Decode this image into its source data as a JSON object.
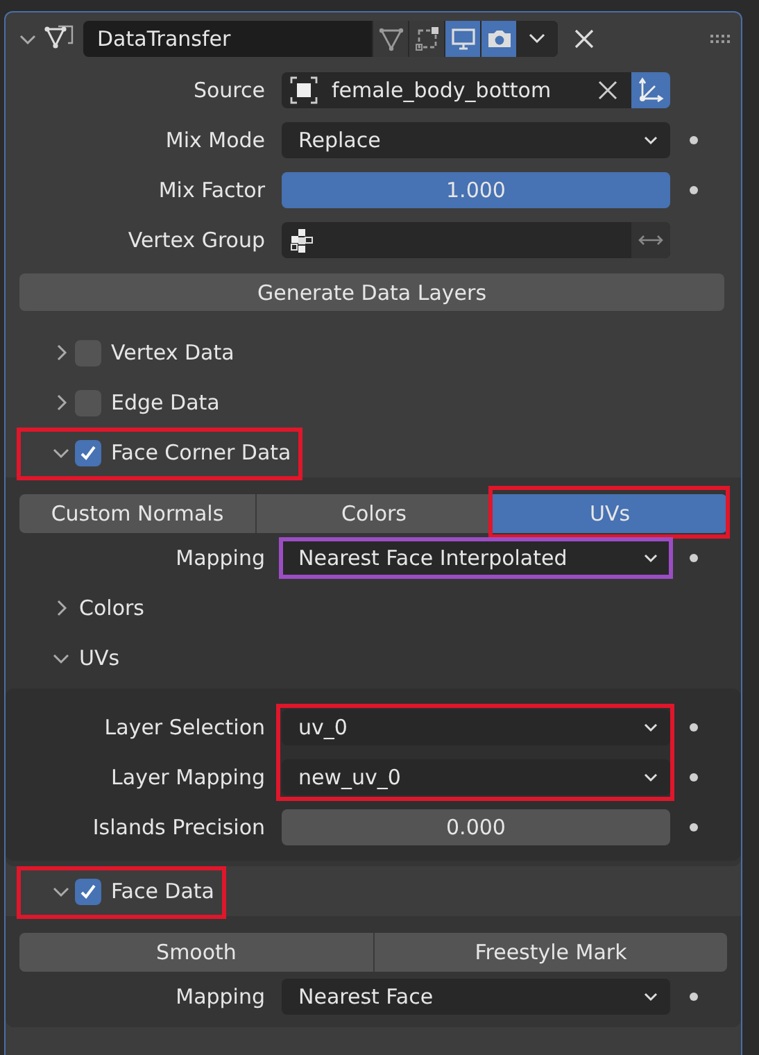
{
  "modifier": {
    "name": "DataTransfer",
    "expanded": true,
    "toggles": [
      {
        "kind": "edit_mode",
        "on": false
      },
      {
        "kind": "cage",
        "on": false
      },
      {
        "kind": "viewport",
        "on": true
      },
      {
        "kind": "render",
        "on": true
      }
    ]
  },
  "properties": [
    {
      "label": "Source",
      "kind": "object",
      "value": "female_body_bottom",
      "keyframe_dot": false,
      "toggle_on": true
    },
    {
      "label": "Mix Mode",
      "kind": "dropdown",
      "value": "Replace",
      "keyframe_dot": true
    },
    {
      "label": "Mix Factor",
      "kind": "slider",
      "value": "1.000",
      "level": 1,
      "keyframe_dot": true
    },
    {
      "label": "Vertex Group",
      "kind": "vertex_group",
      "keyframe_dot": false
    }
  ],
  "generate_button": "Generate Data Layers",
  "sections": [
    {
      "title": "Vertex Data",
      "expanded": false,
      "checked": false
    },
    {
      "title": "Edge Data",
      "expanded": false,
      "checked": false
    },
    {
      "title": "Face Corner Data",
      "expanded": true,
      "checked": true,
      "annotation": {
        "color": "#e0162b"
      },
      "tabs": [
        {
          "label": "Custom Normals",
          "selected": false
        },
        {
          "label": "Colors",
          "selected": false
        },
        {
          "label": "UVs",
          "selected": true,
          "annotation": {
            "color": "#e0162b"
          }
        }
      ],
      "mapping": {
        "label": "Mapping",
        "value": "Nearest Face Interpolated",
        "annotation": {
          "color": "#9b4dc4"
        }
      },
      "subpanels": [
        {
          "title": "Colors",
          "expanded": false
        },
        {
          "title": "UVs",
          "expanded": true,
          "properties": [
            {
              "label": "Layer Selection",
              "kind": "dropdown",
              "value": "uv_0",
              "keyframe_dot": true,
              "annotation": {
                "color": "#e0162b"
              }
            },
            {
              "label": "Layer Mapping",
              "kind": "dropdown",
              "value": "new_uv_0",
              "keyframe_dot": true,
              "annotation": {
                "color": "#e0162b"
              }
            },
            {
              "label": "Islands Precision",
              "kind": "number",
              "value": "0.000",
              "keyframe_dot": true
            }
          ]
        }
      ]
    },
    {
      "title": "Face Data",
      "expanded": true,
      "checked": true,
      "annotation": {
        "color": "#e0162b"
      },
      "tabs": [
        {
          "label": "Smooth",
          "selected": false
        },
        {
          "label": "Freestyle Mark",
          "selected": false
        }
      ],
      "mapping": {
        "label": "Mapping",
        "value": "Nearest Face"
      }
    }
  ]
}
